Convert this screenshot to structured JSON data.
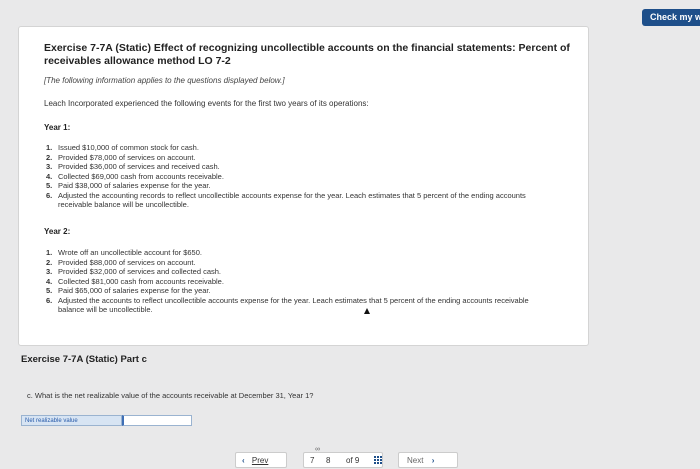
{
  "header": {
    "check_label": "Check my w"
  },
  "problem": {
    "title": "Exercise 7-7A (Static) Effect of recognizing uncollectible accounts on the financial statements: Percent of receivables allowance method LO 7-2",
    "note": "[The following information applies to the questions displayed below.]",
    "intro": "Leach Incorporated experienced the following events for the first two years of its operations:",
    "year1": {
      "label": "Year 1:",
      "items": [
        {
          "num": "1.",
          "text": "Issued $10,000 of common stock for cash."
        },
        {
          "num": "2.",
          "text": "Provided $78,000 of services on account."
        },
        {
          "num": "3.",
          "text": "Provided $36,000 of services and received cash."
        },
        {
          "num": "4.",
          "text": "Collected $69,000 cash from accounts receivable."
        },
        {
          "num": "5.",
          "text": "Paid $38,000 of salaries expense for the year."
        },
        {
          "num": "6.",
          "text": "Adjusted the accounting records to reflect uncollectible accounts expense for the year. Leach estimates that 5 percent of the ending accounts receivable balance will be uncollectible."
        }
      ]
    },
    "year2": {
      "label": "Year 2:",
      "items": [
        {
          "num": "1.",
          "text": "Wrote off an uncollectible account for $650."
        },
        {
          "num": "2.",
          "text": "Provided $88,000 of services on account."
        },
        {
          "num": "3.",
          "text": "Provided $32,000 of services and collected cash."
        },
        {
          "num": "4.",
          "text": "Collected $81,000 cash from accounts receivable."
        },
        {
          "num": "5.",
          "text": "Paid $65,000 of salaries expense for the year."
        },
        {
          "num": "6.",
          "text": "Adjusted the accounts to reflect uncollectible accounts expense for the year. Leach estimates that 5 percent of the ending accounts receivable balance will be uncollectible."
        }
      ]
    }
  },
  "part": {
    "title": "Exercise 7-7A (Static) Part c",
    "question": "c. What is the net realizable value of the accounts receivable at December 31, Year 1?",
    "answer_label": "Net realizable value",
    "answer_value": ""
  },
  "pager": {
    "prev_label": "Prev",
    "page_current_prev": "7",
    "page_current": "8",
    "page_of": "of 9",
    "next_label": "Next"
  },
  "icons": {
    "prev": "chevron-left-icon",
    "next": "chevron-right-icon",
    "grid": "grid-icon",
    "link": "link-icon"
  },
  "colors": {
    "accent": "#1e4f8a",
    "answer_label_bg": "#d7e4f3",
    "answer_label_text": "#2a5caa"
  }
}
